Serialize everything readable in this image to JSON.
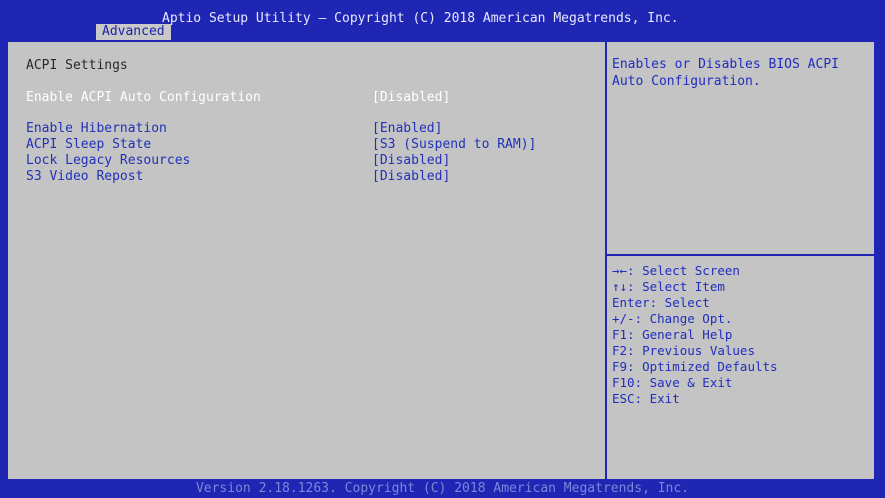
{
  "header": {
    "title": "Aptio Setup Utility – Copyright (C) 2018 American Megatrends, Inc.",
    "tab_label": "Advanced"
  },
  "main": {
    "heading": "ACPI Settings",
    "options": [
      {
        "label": "Enable ACPI Auto Configuration",
        "value": "[Disabled]",
        "selected": true
      },
      {
        "label": "Enable Hibernation",
        "value": "[Enabled]",
        "selected": false
      },
      {
        "label": "ACPI Sleep State",
        "value": "[S3 (Suspend to RAM)]",
        "selected": false
      },
      {
        "label": "Lock Legacy Resources",
        "value": "[Disabled]",
        "selected": false
      },
      {
        "label": "S3 Video Repost",
        "value": "[Disabled]",
        "selected": false
      }
    ]
  },
  "help": {
    "text": "Enables or Disables BIOS ACPI\nAuto Configuration."
  },
  "keys": [
    "→←: Select Screen",
    "↑↓: Select Item",
    "Enter: Select",
    "+/-: Change Opt.",
    "F1: General Help",
    "F2: Previous Values",
    "F9: Optimized Defaults",
    "F10: Save & Exit",
    "ESC: Exit"
  ],
  "footer": {
    "text": "Version 2.18.1263. Copyright (C) 2018 American Megatrends, Inc."
  },
  "colors": {
    "frame": "#1f26b4",
    "panel": "#c4c4c4",
    "option_text": "#2232b8",
    "selected_text": "#ffffff"
  }
}
